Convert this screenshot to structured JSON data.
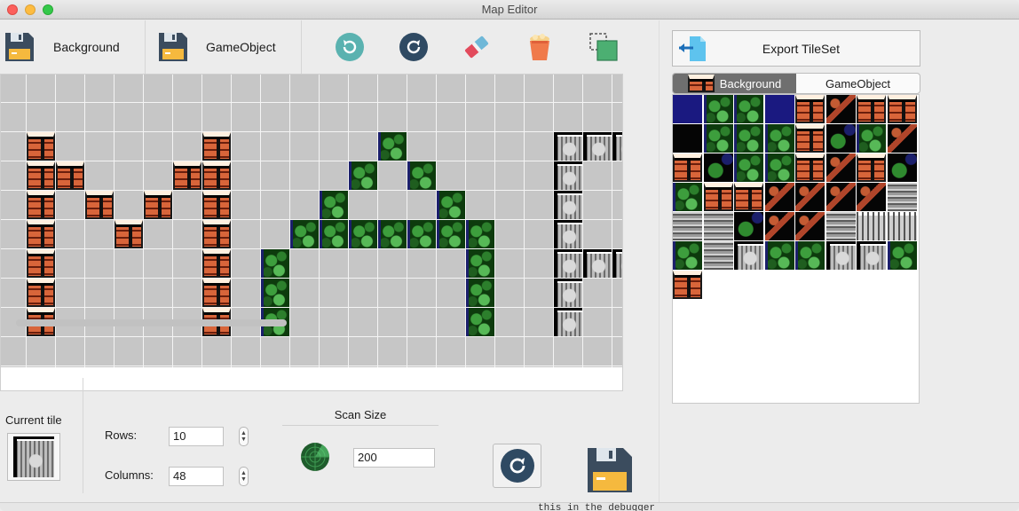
{
  "window": {
    "title": "Map Editor"
  },
  "toolbar": {
    "background_save_label": "Background",
    "gameobject_save_label": "GameObject"
  },
  "icons": {
    "save": "floppy-disk-icon",
    "undo": "rotate-left-icon",
    "redo": "rotate-right-icon",
    "eraser": "eraser-icon",
    "bucket": "paint-bucket-icon",
    "select": "rectangle-select-icon",
    "radar": "radar-icon",
    "export": "export-file-icon"
  },
  "colors": {
    "accent_teal": "#5ab2b0",
    "accent_navy": "#2f4a63",
    "floppy": "#3b4c5e",
    "floppy_label": "#f5b93e"
  },
  "bottom": {
    "current_tile_label": "Current tile",
    "rows_label": "Rows:",
    "rows_value": "10",
    "columns_label": "Columns:",
    "columns_value": "48",
    "scan_size_label": "Scan Size",
    "scan_size_value": "200"
  },
  "right": {
    "export_label": "Export TileSet",
    "tabs": [
      {
        "label": "Background",
        "active": true
      },
      {
        "label": "GameObject",
        "active": false
      }
    ]
  },
  "map": {
    "tiles": [
      {
        "c": 1,
        "r": 2,
        "k": "brick"
      },
      {
        "c": 7,
        "r": 2,
        "k": "brick"
      },
      {
        "c": 13,
        "r": 2,
        "k": "leaf"
      },
      {
        "c": 19,
        "r": 2,
        "k": "rock"
      },
      {
        "c": 20,
        "r": 2,
        "k": "rock"
      },
      {
        "c": 21,
        "r": 2,
        "k": "rock"
      },
      {
        "c": 1,
        "r": 3,
        "k": "brick"
      },
      {
        "c": 2,
        "r": 3,
        "k": "brick"
      },
      {
        "c": 6,
        "r": 3,
        "k": "brick"
      },
      {
        "c": 7,
        "r": 3,
        "k": "brick"
      },
      {
        "c": 12,
        "r": 3,
        "k": "leaf"
      },
      {
        "c": 14,
        "r": 3,
        "k": "leaf"
      },
      {
        "c": 19,
        "r": 3,
        "k": "rock"
      },
      {
        "c": 1,
        "r": 4,
        "k": "brick"
      },
      {
        "c": 3,
        "r": 4,
        "k": "brick"
      },
      {
        "c": 5,
        "r": 4,
        "k": "brick"
      },
      {
        "c": 7,
        "r": 4,
        "k": "brick"
      },
      {
        "c": 11,
        "r": 4,
        "k": "leaf"
      },
      {
        "c": 15,
        "r": 4,
        "k": "leaf"
      },
      {
        "c": 19,
        "r": 4,
        "k": "rock"
      },
      {
        "c": 1,
        "r": 5,
        "k": "brick"
      },
      {
        "c": 4,
        "r": 5,
        "k": "brick"
      },
      {
        "c": 7,
        "r": 5,
        "k": "brick"
      },
      {
        "c": 10,
        "r": 5,
        "k": "leaf"
      },
      {
        "c": 11,
        "r": 5,
        "k": "leaf"
      },
      {
        "c": 12,
        "r": 5,
        "k": "leaf"
      },
      {
        "c": 13,
        "r": 5,
        "k": "leaf"
      },
      {
        "c": 14,
        "r": 5,
        "k": "leaf"
      },
      {
        "c": 15,
        "r": 5,
        "k": "leaf"
      },
      {
        "c": 16,
        "r": 5,
        "k": "leaf"
      },
      {
        "c": 19,
        "r": 5,
        "k": "rock"
      },
      {
        "c": 1,
        "r": 6,
        "k": "brick"
      },
      {
        "c": 7,
        "r": 6,
        "k": "brick"
      },
      {
        "c": 9,
        "r": 6,
        "k": "leaf"
      },
      {
        "c": 16,
        "r": 6,
        "k": "leaf"
      },
      {
        "c": 19,
        "r": 6,
        "k": "rock"
      },
      {
        "c": 20,
        "r": 6,
        "k": "rock"
      },
      {
        "c": 21,
        "r": 6,
        "k": "rock"
      },
      {
        "c": 1,
        "r": 7,
        "k": "brick"
      },
      {
        "c": 7,
        "r": 7,
        "k": "brick"
      },
      {
        "c": 9,
        "r": 7,
        "k": "leaf"
      },
      {
        "c": 16,
        "r": 7,
        "k": "leaf"
      },
      {
        "c": 19,
        "r": 7,
        "k": "rock"
      },
      {
        "c": 1,
        "r": 8,
        "k": "brick"
      },
      {
        "c": 7,
        "r": 8,
        "k": "brick"
      },
      {
        "c": 9,
        "r": 8,
        "k": "leaf"
      },
      {
        "c": 16,
        "r": 8,
        "k": "leaf"
      },
      {
        "c": 19,
        "r": 8,
        "k": "rock"
      }
    ]
  },
  "palette": [
    "night",
    "leaf",
    "leaf",
    "night",
    "brick",
    "mixB",
    "brick",
    "brick",
    "dark",
    "leaf",
    "leaf",
    "leaf",
    "brick",
    "mixA",
    "leaf",
    "mixB",
    "brick",
    "mixA",
    "leaf",
    "leaf",
    "brick",
    "mixB",
    "brick",
    "mixA",
    "leaf",
    "brick",
    "brick",
    "mixB",
    "mixB",
    "mixB",
    "mixB",
    "grey",
    "grey",
    "grey",
    "mixA",
    "mixB",
    "mixB",
    "grey",
    "fence",
    "fence",
    "leaf",
    "grey",
    "rock",
    "leaf",
    "leaf",
    "rock",
    "rock",
    "leaf",
    "brick"
  ],
  "footer": {
    "snippet": "this in the debugger"
  }
}
